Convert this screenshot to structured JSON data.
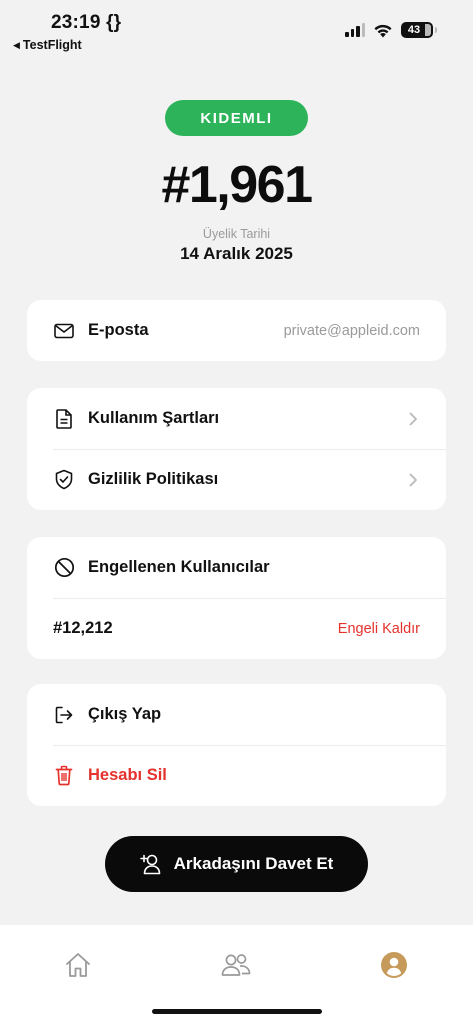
{
  "status_bar": {
    "time": "23:19 {}",
    "back_label": "TestFlight",
    "battery": "43"
  },
  "profile": {
    "badge": "KIDEMLI",
    "member_number": "#1,961",
    "join_label": "Üyelik Tarihi",
    "join_date": "14 Aralık 2025"
  },
  "account": {
    "email_label": "E-posta",
    "email_value": "private@appleid.com"
  },
  "legal": {
    "terms_label": "Kullanım Şartları",
    "privacy_label": "Gizlilik Politikası"
  },
  "blocked": {
    "title": "Engellenen Kullanıcılar",
    "user": "#12,212",
    "unblock_label": "Engeli Kaldır"
  },
  "session": {
    "logout_label": "Çıkış Yap",
    "delete_label": "Hesabı Sil"
  },
  "invite": {
    "label": "Arkadaşını Davet Et"
  },
  "tabs": {
    "items": [
      "home-icon",
      "people-icon",
      "profile-icon"
    ],
    "active": "profile-icon"
  },
  "colors": {
    "accent_green": "#2db35a",
    "danger_red": "#e5322d",
    "active_tab": "#c69a5a",
    "inactive_tab": "#9a9a9a"
  }
}
